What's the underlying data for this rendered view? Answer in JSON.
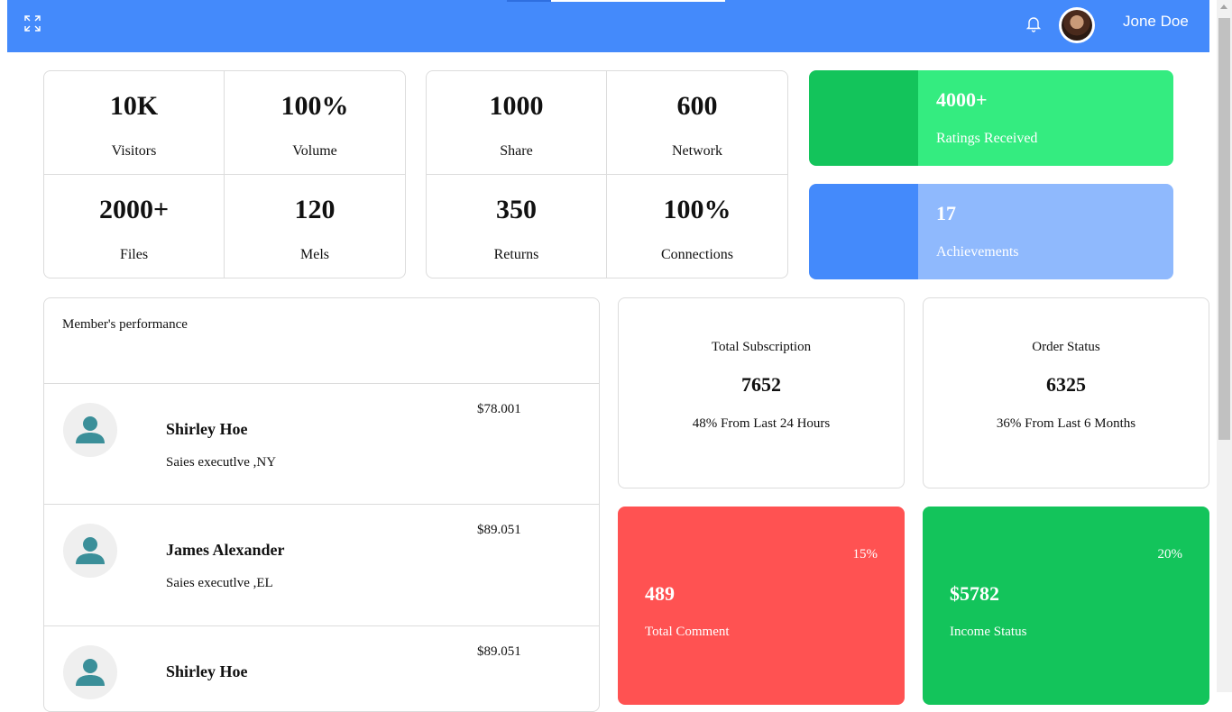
{
  "header": {
    "username": "Jone Doe",
    "expand_icon": "expand-icon",
    "bell_icon": "bell-icon",
    "accent": "#448afb"
  },
  "stats_a": [
    {
      "value": "10K",
      "label": "Visitors"
    },
    {
      "value": "100%",
      "label": "Volume"
    },
    {
      "value": "2000+",
      "label": "Files"
    },
    {
      "value": "120",
      "label": "Mels"
    }
  ],
  "stats_b": [
    {
      "value": "1000",
      "label": "Share"
    },
    {
      "value": "600",
      "label": "Network"
    },
    {
      "value": "350",
      "label": "Returns"
    },
    {
      "value": "100%",
      "label": "Connections"
    }
  ],
  "highlight_cards": [
    {
      "value": "4000+",
      "label": "Ratings Received",
      "color": "#34ec80"
    },
    {
      "value": "17",
      "label": "Achievements",
      "color": "#8fb9fd"
    }
  ],
  "performance": {
    "title": "Member's performance",
    "members": [
      {
        "name": "Shirley Hoe",
        "role": "Saies executlve ,NY",
        "amount": "$78.001"
      },
      {
        "name": "James Alexander",
        "role": "Saies executlve ,EL",
        "amount": "$89.051"
      },
      {
        "name": "Shirley Hoe",
        "role": "",
        "amount": "$89.051"
      }
    ],
    "avatar_icon": "user-icon"
  },
  "summary": [
    {
      "title": "Total Subscription",
      "value": "7652",
      "detail": "48% From Last 24 Hours"
    },
    {
      "title": "Order Status",
      "value": "6325",
      "detail": "36% From Last 6 Months"
    }
  ],
  "bottom_cards": [
    {
      "percent": "15%",
      "value": "489",
      "label": "Total Comment",
      "color": "#ff5252"
    },
    {
      "percent": "20%",
      "value": "$5782",
      "label": "Income Status",
      "color": "#13c45b"
    }
  ]
}
